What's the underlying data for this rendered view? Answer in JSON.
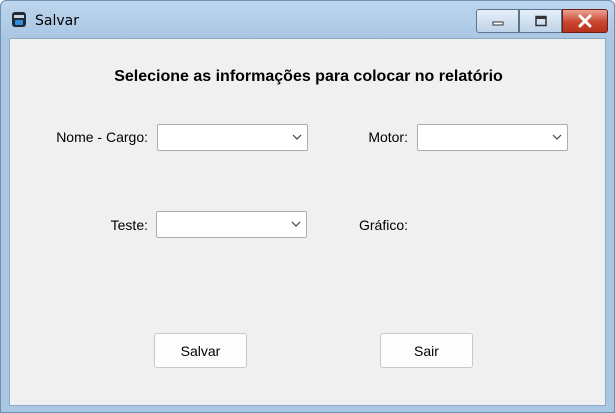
{
  "window": {
    "title": "Salvar",
    "controls": {
      "minimize": "minimize-icon",
      "maximize": "maximize-icon",
      "close": "close-icon"
    }
  },
  "form": {
    "heading": "Selecione as informações para colocar no relatório",
    "fields": {
      "nome_cargo": {
        "label": "Nome - Cargo:",
        "value": ""
      },
      "motor": {
        "label": "Motor:",
        "value": ""
      },
      "teste": {
        "label": "Teste:",
        "value": ""
      },
      "grafico": {
        "label": "Gráfico:"
      }
    },
    "buttons": {
      "salvar": "Salvar",
      "sair": "Sair"
    }
  },
  "colors": {
    "titlebar": "#a9c6e3",
    "client": "#f0f0f0",
    "close": "#c9452f"
  }
}
